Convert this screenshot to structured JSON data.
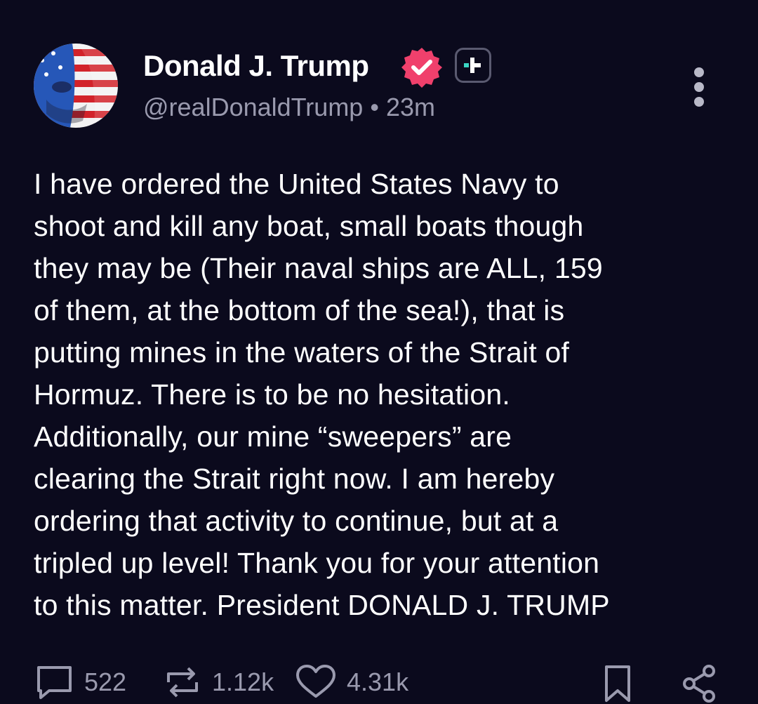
{
  "author": {
    "name": "Donald J. Trump",
    "handle": "@realDonaldTrump",
    "separator": "•",
    "time": "23m",
    "verified_color": "#f0406c",
    "plus_accent": "#3ad6c4"
  },
  "post": {
    "lines": [
      "I have ordered the United States Navy to",
      "shoot and kill any boat, small boats though",
      "they may be (Their naval ships are ALL, 159",
      "of them, at the bottom of the sea!), that is",
      "putting mines in the waters of the Strait of",
      "Hormuz. There is to be no hesitation.",
      "Additionally, our mine “sweepers” are",
      "clearing the Strait right now. I am hereby",
      "ordering that activity to continue, but at a",
      "tripled up level! Thank you for your attention",
      "to this matter. President DONALD J. TRUMP"
    ]
  },
  "actions": {
    "replies": "522",
    "reposts": "1.12k",
    "likes": "4.31k",
    "icons": [
      "comment-icon",
      "repost-icon",
      "heart-icon",
      "bookmark-icon",
      "share-icon"
    ]
  },
  "colors": {
    "background": "#0b0a1d",
    "text": "#ffffff",
    "muted": "#9a9aae"
  }
}
